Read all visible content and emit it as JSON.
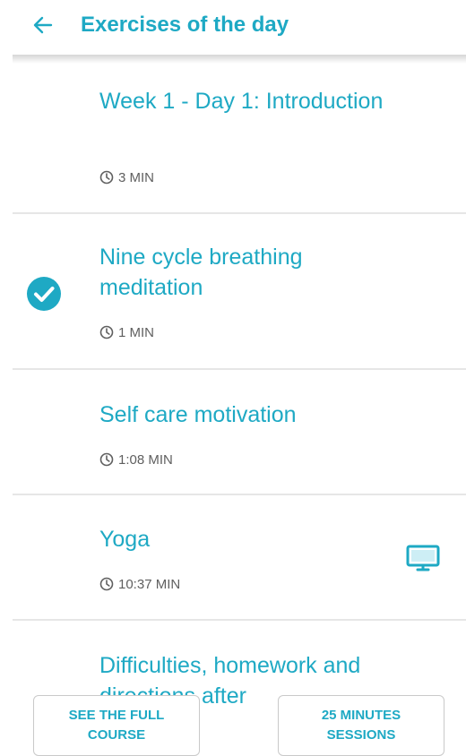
{
  "header": {
    "title": "Exercises of the day",
    "back_icon": "arrow-left-icon"
  },
  "colors": {
    "accent": "#1ea9c4",
    "text_secondary": "#5f5f5f",
    "divider": "#e6e6e6"
  },
  "exercises": [
    {
      "title": "Week 1 - Day 1: Introduction",
      "duration": "3 MIN",
      "completed": false,
      "video": false
    },
    {
      "title": "Nine cycle breathing meditation",
      "duration": "1 MIN",
      "completed": true,
      "video": false
    },
    {
      "title": "Self care motivation",
      "duration": "1:08 MIN",
      "completed": false,
      "video": false
    },
    {
      "title": "Yoga",
      "duration": "10:37 MIN",
      "completed": false,
      "video": true
    },
    {
      "title": "Difficulties, homework and directions after",
      "duration": "",
      "completed": false,
      "video": false
    }
  ],
  "buttons": {
    "full_course": "SEE THE FULL COURSE",
    "sessions": "25 MINUTES SESSIONS"
  }
}
